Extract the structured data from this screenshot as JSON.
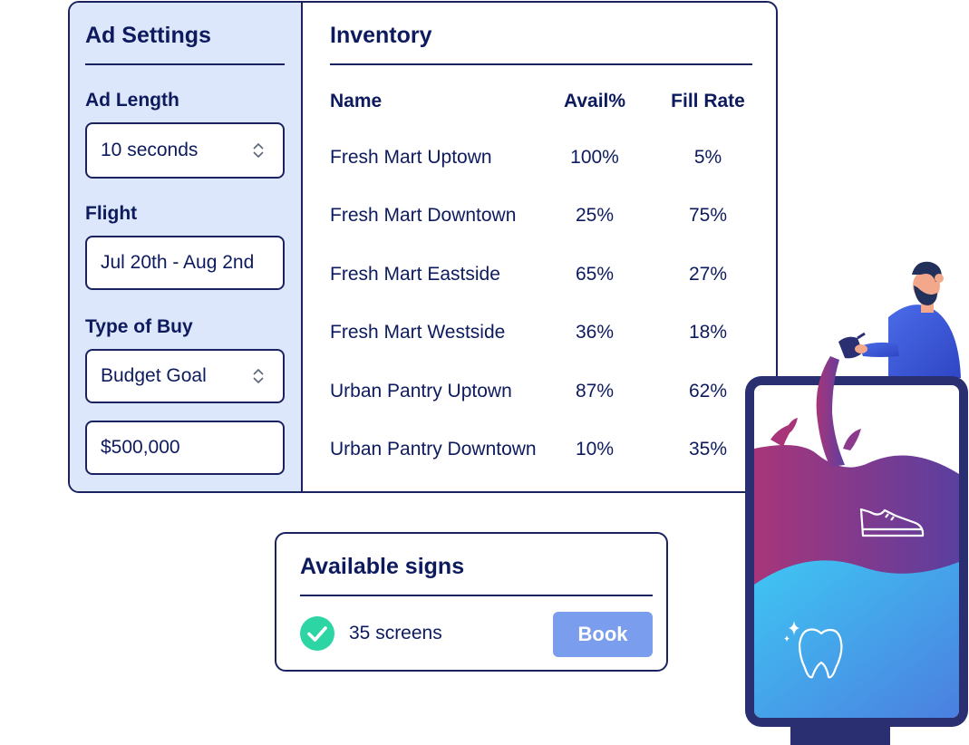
{
  "ad_settings": {
    "title": "Ad Settings",
    "ad_length": {
      "label": "Ad Length",
      "value": "10 seconds"
    },
    "flight": {
      "label": "Flight",
      "value": "Jul 20th - Aug 2nd"
    },
    "type_of_buy": {
      "label": "Type of Buy",
      "value": "Budget Goal"
    },
    "budget": {
      "value": "$500,000"
    }
  },
  "inventory": {
    "title": "Inventory",
    "columns": [
      "Name",
      "Avail%",
      "Fill Rate"
    ],
    "rows": [
      {
        "name": "Fresh Mart Uptown",
        "avail": "100%",
        "fill": "5%"
      },
      {
        "name": "Fresh Mart Downtown",
        "avail": "25%",
        "fill": "75%"
      },
      {
        "name": "Fresh Mart Eastside",
        "avail": "65%",
        "fill": "27%"
      },
      {
        "name": "Fresh Mart Westside",
        "avail": "36%",
        "fill": "18%"
      },
      {
        "name": "Urban Pantry Uptown",
        "avail": "87%",
        "fill": "62%"
      },
      {
        "name": "Urban Pantry Downtown",
        "avail": "10%",
        "fill": "35%"
      }
    ]
  },
  "available_signs": {
    "title": "Available signs",
    "count_text": "35 screens",
    "book_label": "Book",
    "status_icon": "check-circle-icon",
    "status_color": "#2dd4a4"
  },
  "colors": {
    "navy": "#1a2360",
    "panel_bg": "#dde7fb",
    "button": "#7b9ded"
  },
  "illustration": {
    "icons": [
      "sneaker-icon",
      "tooth-icon",
      "sparkle-icon"
    ]
  }
}
